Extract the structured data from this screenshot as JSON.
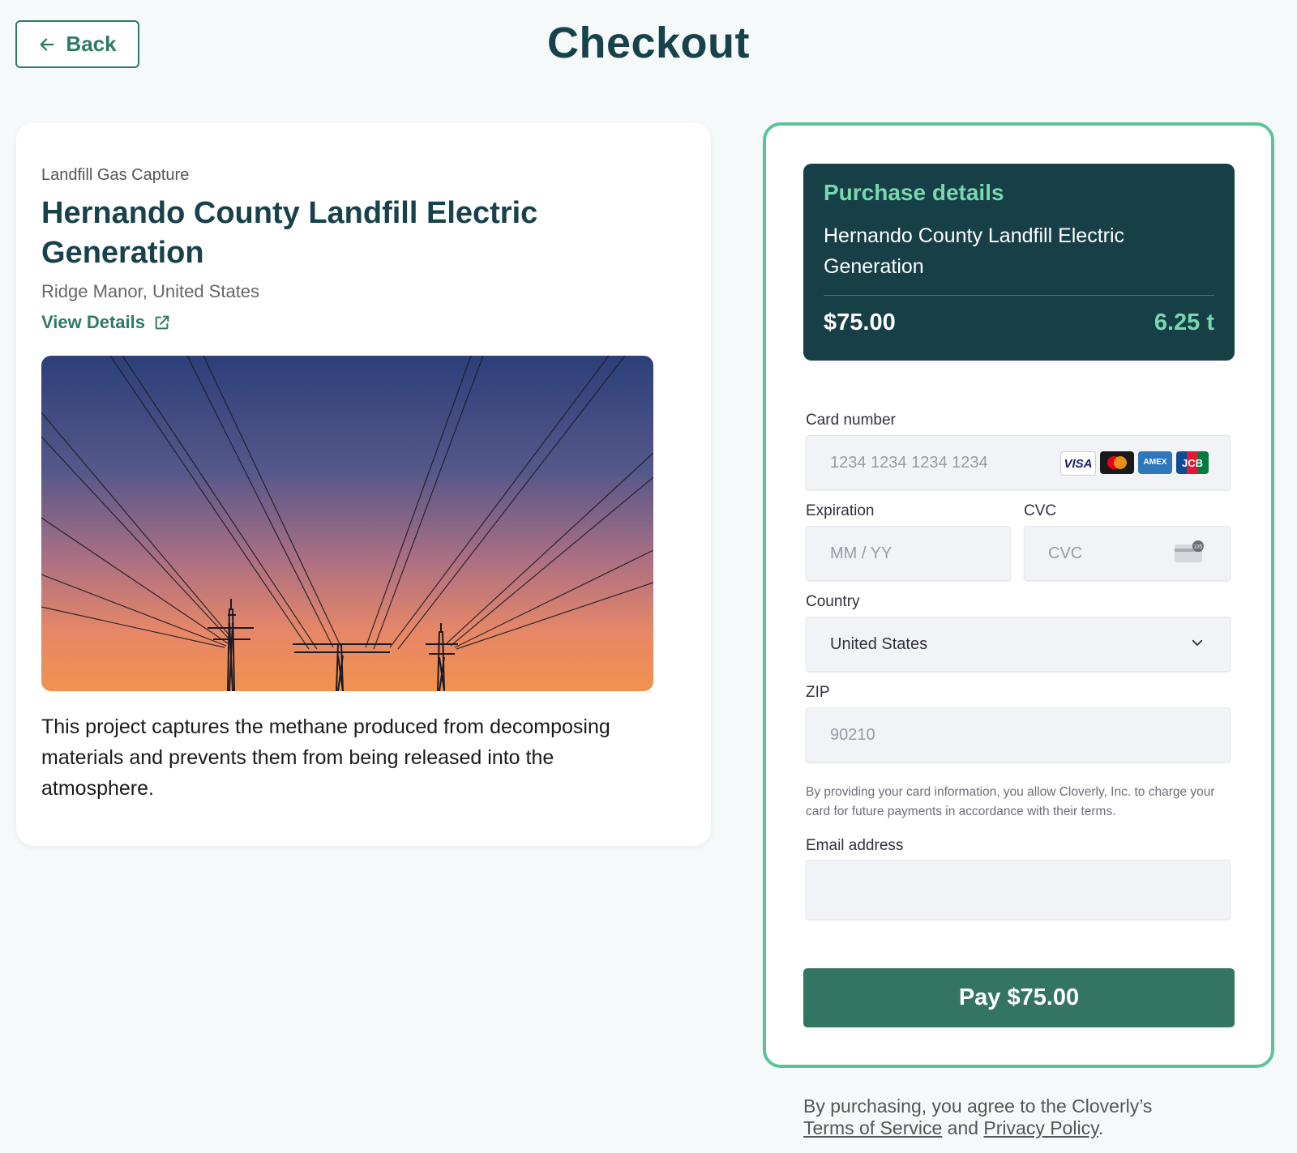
{
  "header": {
    "back_label": "Back",
    "title": "Checkout"
  },
  "project": {
    "category": "Landfill Gas Capture",
    "title": "Hernando County Landfill Electric Generation",
    "location": "Ridge Manor, United States",
    "view_details_label": "View Details",
    "image_icon": "power-lines-sunset-image",
    "description": "This project captures the methane produced from decomposing materials and prevents them from being released into the atmosphere."
  },
  "purchase": {
    "heading": "Purchase details",
    "project_name": "Hernando County Landfill Electric Generation",
    "price": "$75.00",
    "tons": "6.25 t"
  },
  "form": {
    "card_number_label": "Card number",
    "card_number_placeholder": "1234 1234 1234 1234",
    "card_brands": [
      "VISA",
      "mastercard",
      "AMEX",
      "JCB"
    ],
    "expiration_label": "Expiration",
    "expiration_placeholder": "MM / YY",
    "cvc_label": "CVC",
    "cvc_placeholder": "CVC",
    "cvc_icon_text": "135",
    "country_label": "Country",
    "country_value": "United States",
    "zip_label": "ZIP",
    "zip_placeholder": "90210",
    "consent": "By providing your card information, you allow Cloverly, Inc. to charge your card for future payments in accordance with their terms.",
    "email_label": "Email address",
    "email_value": "",
    "pay_label": "Pay $75.00"
  },
  "footer": {
    "prefix": "By purchasing, you agree to the Cloverly’s",
    "tos_label": "Terms of Service",
    "and": "and",
    "privacy_label": "Privacy Policy",
    "suffix": "."
  },
  "colors": {
    "accent": "#2f7a66",
    "panel_border": "#5bc494",
    "dark_teal": "#173f47",
    "pay_button": "#347462"
  }
}
